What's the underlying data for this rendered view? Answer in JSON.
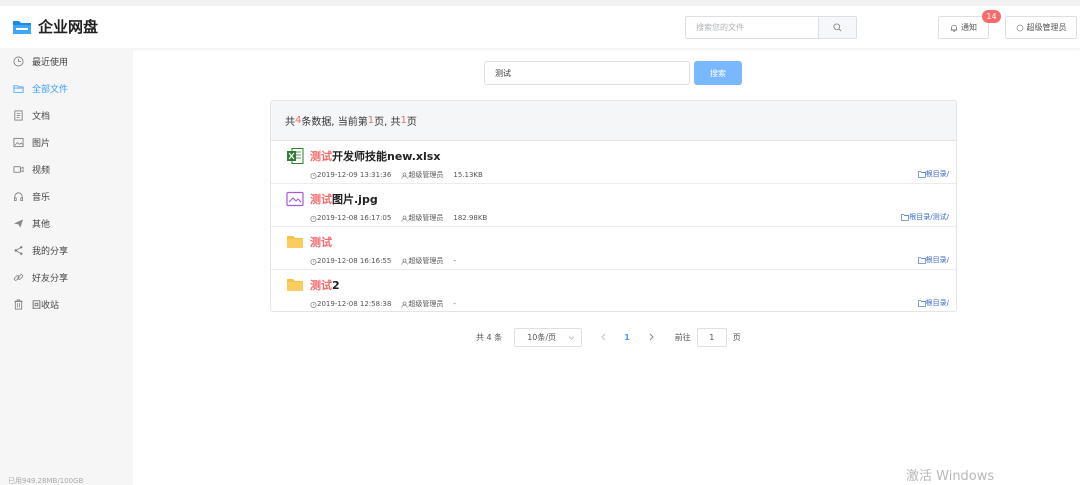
{
  "header": {
    "app_title": "企业网盘",
    "search_placeholder": "搜索您的文件",
    "notify_label": "通知",
    "notify_count": "14",
    "user_label": "超级管理员"
  },
  "sidebar": {
    "items": [
      {
        "label": "最近使用",
        "icon": "clock-icon"
      },
      {
        "label": "全部文件",
        "icon": "folder-icon"
      },
      {
        "label": "文档",
        "icon": "document-icon"
      },
      {
        "label": "图片",
        "icon": "image-icon"
      },
      {
        "label": "视频",
        "icon": "video-icon"
      },
      {
        "label": "音乐",
        "icon": "headphones-icon"
      },
      {
        "label": "其他",
        "icon": "send-icon"
      },
      {
        "label": "我的分享",
        "icon": "share-icon"
      },
      {
        "label": "好友分享",
        "icon": "link-icon"
      },
      {
        "label": "回收站",
        "icon": "trash-icon"
      }
    ],
    "active_index": 1,
    "storage": "已用949.28MB/100GB"
  },
  "search": {
    "value": "测试",
    "button_label": "搜索"
  },
  "results": {
    "summary_prefix": "共",
    "count": "4",
    "summary_mid": "条数据, 当前第",
    "page": "1",
    "summary_mid2": "页, 共",
    "pages": "1",
    "summary_suffix": "页",
    "files": [
      {
        "name_hl": "测试",
        "name_rest": "开发师技能new.xlsx",
        "icon": "excel-icon",
        "time": "2019-12-09 13:31:36",
        "owner": "超级管理员",
        "size": "15.13KB",
        "path": "根目录/"
      },
      {
        "name_hl": "测试",
        "name_rest": "图片.jpg",
        "icon": "image-file-icon",
        "time": "2019-12-08 16:17:05",
        "owner": "超级管理员",
        "size": "182.98KB",
        "path": "根目录/测试/"
      },
      {
        "name_hl": "测试",
        "name_rest": "",
        "icon": "folder-icon",
        "time": "2019-12-08 16:16:55",
        "owner": "超级管理员",
        "size": "-",
        "path": "根目录/"
      },
      {
        "name_hl": "测试",
        "name_rest": "2",
        "icon": "folder-icon",
        "time": "2019-12-08 12:58:38",
        "owner": "超级管理员",
        "size": "-",
        "path": "根目录/"
      }
    ]
  },
  "pager": {
    "total": "共 4 条",
    "page_size": "10条/页",
    "current": "1",
    "goto_prefix": "前往",
    "goto_value": "1",
    "goto_suffix": "页"
  },
  "watermark": "激活 Windows",
  "colors": {
    "accent": "#409eff",
    "highlight": "#f56c6c",
    "path": "#3a68c9",
    "folder": "#f7c04a"
  }
}
